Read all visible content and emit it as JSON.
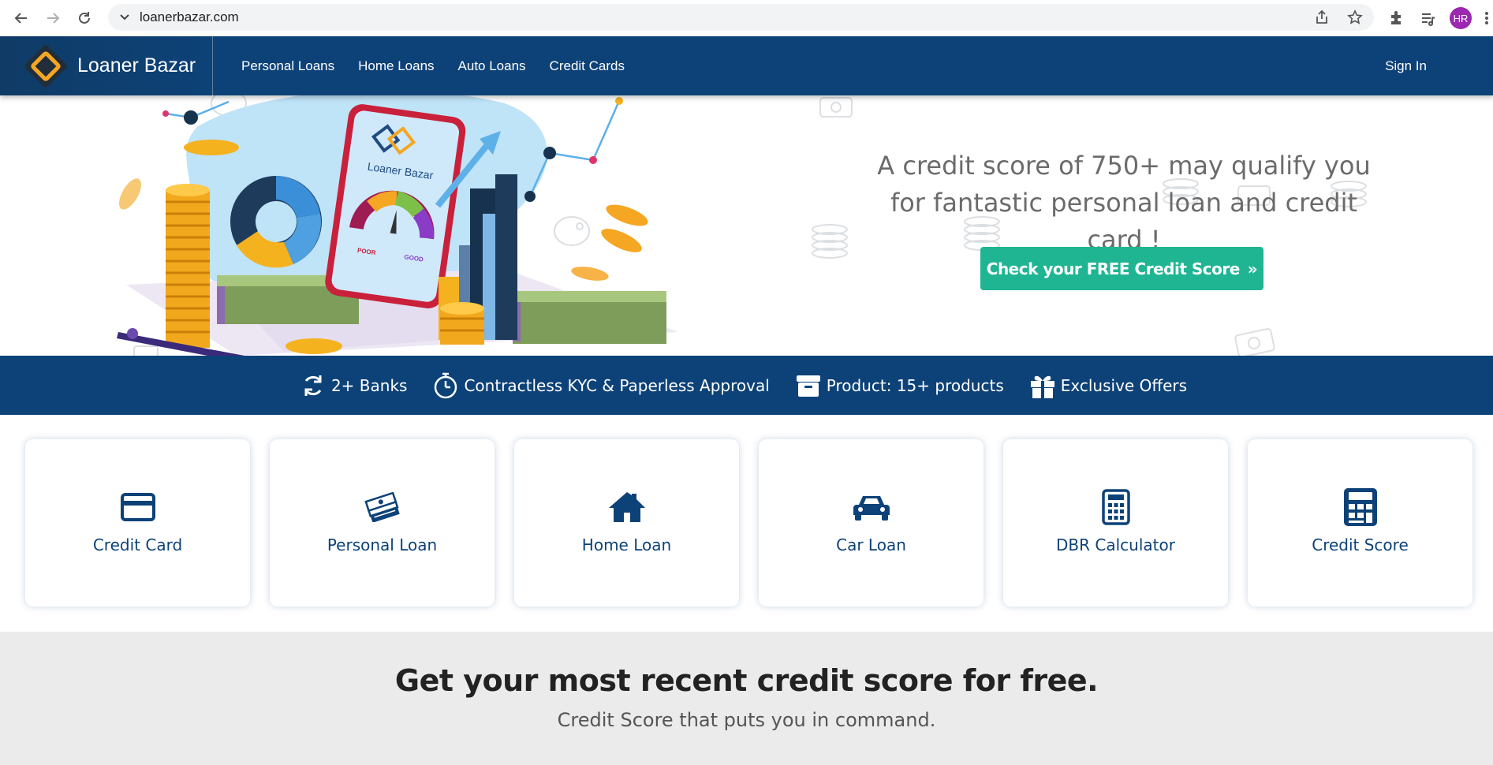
{
  "browser": {
    "url": "loanerbazar.com",
    "avatar_initials": "HR"
  },
  "header": {
    "brand": "Loaner Bazar",
    "nav": [
      "Personal Loans",
      "Home Loans",
      "Auto Loans",
      "Credit Cards"
    ],
    "sign_in": "Sign In"
  },
  "hero": {
    "headline": "A credit score of 750+ may qualify you for fantastic personal loan and credit card !",
    "cta_label": "Check your FREE Credit Score",
    "phone_brand": "Loaner Bazar",
    "gauge_poor": "POOR",
    "gauge_good": "GOOD"
  },
  "features": [
    {
      "icon": "sync-icon",
      "label": "2+ Banks"
    },
    {
      "icon": "stopwatch-icon",
      "label": "Contractless KYC & Paperless Approval"
    },
    {
      "icon": "archive-box-icon",
      "label": "Product: 15+ products"
    },
    {
      "icon": "gift-icon",
      "label": "Exclusive Offers"
    }
  ],
  "products": [
    {
      "icon": "credit-card-icon",
      "label": "Credit Card"
    },
    {
      "icon": "money-stack-icon",
      "label": "Personal Loan"
    },
    {
      "icon": "home-icon",
      "label": "Home Loan"
    },
    {
      "icon": "car-icon",
      "label": "Car Loan"
    },
    {
      "icon": "calculator-outline-icon",
      "label": "DBR Calculator"
    },
    {
      "icon": "calculator-icon",
      "label": "Credit Score"
    }
  ],
  "score_section": {
    "title": "Get your most recent credit score for free.",
    "subtitle": "Credit Score that puts you in command."
  },
  "colors": {
    "brand_navy": "#0d4278",
    "cta_green": "#1fb592",
    "accent_gold": "#f5a623"
  }
}
